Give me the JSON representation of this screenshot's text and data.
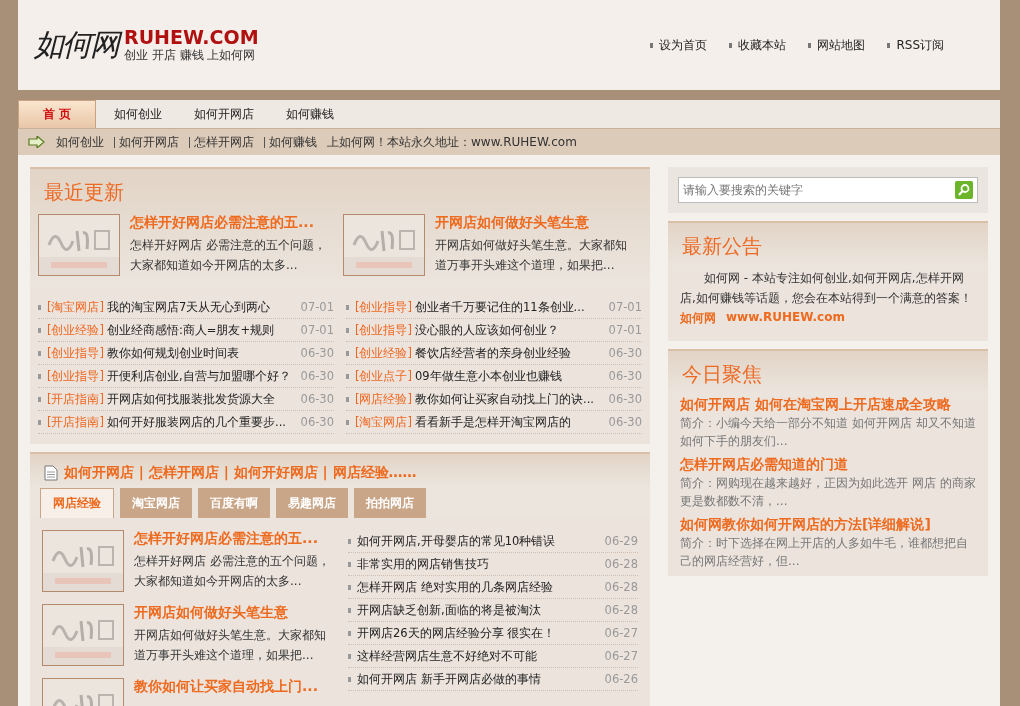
{
  "header": {
    "logo_mark": "如何网",
    "logo_domain": "RUHEW.COM",
    "tagline": "创业 开店 赚钱 上如何网",
    "links": [
      "设为首页",
      "收藏本站",
      "网站地图",
      "RSS订阅"
    ]
  },
  "nav": {
    "tabs": [
      {
        "label": "首 页",
        "selected": true
      },
      {
        "label": "如何创业",
        "selected": false
      },
      {
        "label": "如何开网店",
        "selected": false
      },
      {
        "label": "如何赚钱",
        "selected": false
      }
    ]
  },
  "ticker": {
    "links": [
      "如何创业",
      "如何开网店",
      "怎样开网店",
      "如何赚钱"
    ],
    "text": "上如何网！本站永久地址：www.RUHEW.com"
  },
  "recent": {
    "title": "最近更新",
    "features": [
      {
        "title": "怎样开好网店必需注意的五...",
        "excerpt": "怎样开好网店 必需注意的五个问题，大家都知道如今开网店的太多..."
      },
      {
        "title": "开网店如何做好头笔生意",
        "excerpt": "开网店如何做好头笔生意。大家都知道万事开头难这个道理，如果把..."
      }
    ],
    "lists": [
      [
        {
          "tag": "[淘宝网店]",
          "title": "我的淘宝网店7天从无心到两心",
          "date": "07-01"
        },
        {
          "tag": "[创业经验]",
          "title": "创业经商感悟:商人=朋友+规则",
          "date": "07-01"
        },
        {
          "tag": "[创业指导]",
          "title": "教你如何规划创业时间表",
          "date": "06-30"
        },
        {
          "tag": "[创业指导]",
          "title": "开便利店创业,自营与加盟哪个好？",
          "date": "06-30"
        },
        {
          "tag": "[开店指南]",
          "title": "开网店如何找服装批发货源大全",
          "date": "06-30"
        },
        {
          "tag": "[开店指南]",
          "title": "如何开好服装网店的几个重要步...",
          "date": "06-30"
        }
      ],
      [
        {
          "tag": "[创业指导]",
          "title": "创业者千万要记住的11条创业...",
          "date": "07-01"
        },
        {
          "tag": "[创业指导]",
          "title": "没心眼的人应该如何创业？",
          "date": "07-01"
        },
        {
          "tag": "[创业经验]",
          "title": "餐饮店经营者的亲身创业经验",
          "date": "06-30"
        },
        {
          "tag": "[创业点子]",
          "title": "09年做生意小本创业也赚钱",
          "date": "06-30"
        },
        {
          "tag": "[网店经验]",
          "title": "教你如何让买家自动找上门的诀...",
          "date": "06-30"
        },
        {
          "tag": "[淘宝网店]",
          "title": "看看新手是怎样开淘宝网店的",
          "date": "06-30"
        }
      ]
    ]
  },
  "shops": {
    "heading": "如何开网店 | 怎样开网店 | 如何开好网店 | 网店经验……",
    "tabs": [
      {
        "label": "网店经验",
        "selected": true
      },
      {
        "label": "淘宝网店",
        "selected": false
      },
      {
        "label": "百度有啊",
        "selected": false
      },
      {
        "label": "易趣网店",
        "selected": false
      },
      {
        "label": "拍拍网店",
        "selected": false
      }
    ],
    "features": [
      {
        "title": "怎样开好网店必需注意的五...",
        "excerpt": "怎样开好网店 必需注意的五个问题，大家都知道如今开网店的太多..."
      },
      {
        "title": "开网店如何做好头笔生意",
        "excerpt": "开网店如何做好头笔生意。大家都知道万事开头难这个道理，如果把..."
      },
      {
        "title": "教你如何让买家自动找上门..."
      }
    ],
    "list": [
      {
        "title": "如何开网店,开母婴店的常见10种错误",
        "date": "06-29"
      },
      {
        "title": "非常实用的网店销售技巧",
        "date": "06-28"
      },
      {
        "title": "怎样开网店 绝对实用的几条网店经验",
        "date": "06-28"
      },
      {
        "title": "开网店缺乏创新,面临的将是被淘汰",
        "date": "06-28"
      },
      {
        "title": "开网店26天的网店经验分享 很实在！",
        "date": "06-27"
      },
      {
        "title": "这样经营网店生意不好绝对不可能",
        "date": "06-27"
      },
      {
        "title": "如何开网店 新手开网店必做的事情",
        "date": "06-26"
      }
    ]
  },
  "search": {
    "placeholder": "请输入要搜索的关键字"
  },
  "notice": {
    "title": "最新公告",
    "text": "如何网 - 本站专注如何创业,如何开网店,怎样开网店,如何赚钱等话题，您会在本站得到一个满意的答案！",
    "signature": "如何网",
    "url": "www.RUHEW.com"
  },
  "focus": {
    "title": "今日聚焦",
    "items": [
      {
        "title": "如何开网店 如何在淘宝网上开店速成全攻略",
        "summary": "简介：小编今天给一部分不知道 如何开网店 却又不知道如何下手的朋友们..."
      },
      {
        "title": "怎样开网店必需知道的门道",
        "summary": "简介：网购现在越来越好，正因为如此选开 网店 的商家更是数都数不清，..."
      },
      {
        "title": "如何网教你如何开网店的方法[详细解说]",
        "summary": "简介：时下选择在网上开店的人多如牛毛，谁都想把自己的网店经营好，但..."
      }
    ]
  }
}
